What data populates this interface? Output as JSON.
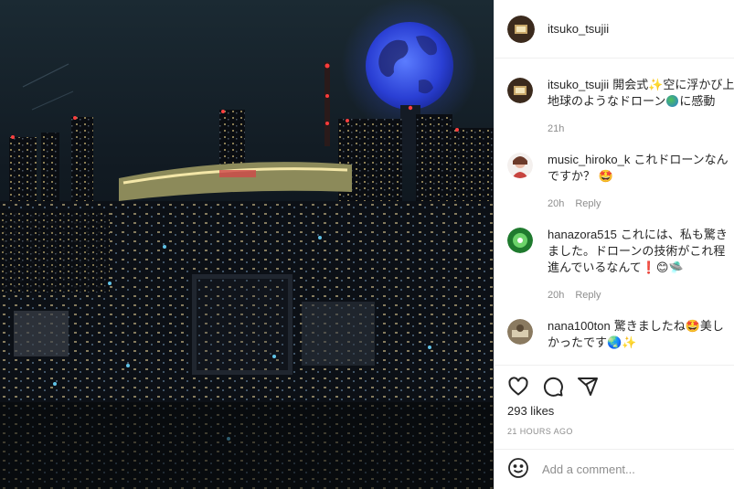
{
  "post": {
    "username": "itsuko_tsujii"
  },
  "caption": {
    "username": "itsuko_tsujii",
    "text_line1": "開会式✨空に浮かび上がった",
    "text_line2": "地球のようなドローン",
    "text_line2_tail": "に感動",
    "time": "21h"
  },
  "comments": [
    {
      "username": "music_hiroko_k",
      "text": "これドローンなんですか？ 🤩",
      "time": "20h",
      "reply": "Reply"
    },
    {
      "username": "hanazora515",
      "text": "これには、私も驚きました。ドローンの技術がこれ程進んでいるなんて❗😊🛸",
      "time": "20h",
      "reply": "Reply"
    },
    {
      "username": "nana100ton",
      "text": "驚きましたね🤩美しかったです🌏✨"
    }
  ],
  "stats": {
    "likes": "293 likes",
    "time_ago": "21 HOURS AGO"
  },
  "add_comment": {
    "placeholder": "Add a comment..."
  },
  "icons": {
    "like": "heart-icon",
    "comment": "comment-icon",
    "share": "send-icon",
    "emoji": "smiley-icon"
  },
  "colors": {
    "text": "#262626",
    "muted": "#8e8e8e",
    "divider": "#efefef",
    "globe": "#2a4bd8"
  }
}
